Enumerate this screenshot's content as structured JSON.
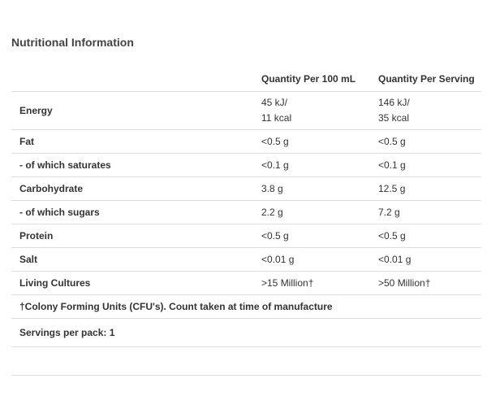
{
  "title": "Nutritional Information",
  "table": {
    "headers": [
      "",
      "Quantity Per 100 mL",
      "Quantity Per Serving"
    ],
    "energy": {
      "name": "Energy",
      "per100": [
        "45 kJ/",
        "11 kcal"
      ],
      "perServing": [
        "146 kJ/",
        "35 kcal"
      ]
    },
    "rows": [
      {
        "name": "Fat",
        "per100": "<0.5 g",
        "perServing": "<0.5 g"
      },
      {
        "name": "- of which saturates",
        "per100": "<0.1 g",
        "perServing": "<0.1 g"
      },
      {
        "name": "Carbohydrate",
        "per100": "3.8 g",
        "perServing": "12.5 g"
      },
      {
        "name": "- of which sugars",
        "per100": "2.2 g",
        "perServing": "7.2 g"
      },
      {
        "name": "Protein",
        "per100": "<0.5 g",
        "perServing": "<0.5 g"
      },
      {
        "name": "Salt",
        "per100": "<0.01 g",
        "perServing": "<0.01 g"
      },
      {
        "name": "Living Cultures",
        "per100": ">15 Million†",
        "perServing": ">50 Million†"
      }
    ],
    "footnote": "†Colony Forming Units (CFU's). Count taken at time of manufacture",
    "servings": "Servings per pack: 1"
  }
}
